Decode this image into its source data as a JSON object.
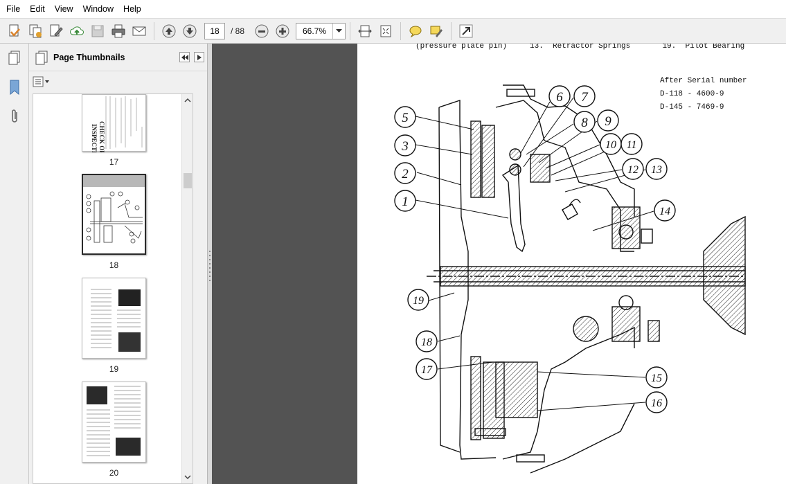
{
  "menu": [
    "File",
    "Edit",
    "View",
    "Window",
    "Help"
  ],
  "toolbar": {
    "page_current": "18",
    "page_total": "/ 88",
    "zoom": "66.7%"
  },
  "panel": {
    "title": "Page Thumbnails"
  },
  "thumbnails": [
    {
      "label": "17"
    },
    {
      "label": "18"
    },
    {
      "label": "19"
    },
    {
      "label": "20"
    }
  ],
  "document": {
    "header_line": "(pressure plate pin)     13.  Retractor Springs       19.  Pilot Bearing",
    "note_line1": "After Serial number",
    "note_line2": "D-118 - 4600-9",
    "note_line3": "D-145 - 7469-9",
    "callouts": [
      "5",
      "3",
      "2",
      "1",
      "6",
      "7",
      "8",
      "9",
      "10",
      "11",
      "12",
      "13",
      "14",
      "19",
      "18",
      "17",
      "15",
      "16"
    ]
  }
}
